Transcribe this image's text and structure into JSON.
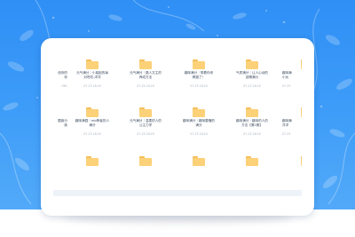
{
  "file_rows": [
    [
      {
        "name": "信你的\n你",
        "date": "ORL",
        "partial": "left"
      },
      {
        "name": "元气满分｜小姐姐的每\n对吃吃-洋洋",
        "date": "07-23 16:20"
      },
      {
        "name": "元气满分｜路人文主的\n养成方法",
        "date": "07-23 16:20"
      },
      {
        "name": "趣味满分｜带着你来\n教猫了！",
        "date": "07-23 16:20"
      },
      {
        "name": "气质满分｜让人心动的\n欲情满分",
        "date": "07-23 16:20"
      },
      {
        "name": "趣味满\n小伙",
        "date": "07-23",
        "partial": "right"
      }
    ],
    [
      {
        "name": "酸爽分\n妹",
        "date": "",
        "partial": "left"
      },
      {
        "name": "趣味满园｜mb等者的人\n满分",
        "date": "07-23 16:20"
      },
      {
        "name": "元气满分｜温柔的人的\n公主力学",
        "date": "07-23 16:20"
      },
      {
        "name": "趣味满分｜趣味要懂的\n满分",
        "date": "07-23 16:20"
      },
      {
        "name": "趣味满分｜趣味的人的\n方法【第2期】",
        "date": "07-23 16:20"
      },
      {
        "name": "趣味满\n洋洋",
        "date": "07-23",
        "partial": "right"
      }
    ],
    [
      {
        "name": "",
        "date": "",
        "partial": "left"
      },
      {
        "name": "",
        "date": ""
      },
      {
        "name": "",
        "date": ""
      },
      {
        "name": "",
        "date": ""
      },
      {
        "name": "",
        "date": ""
      },
      {
        "name": "",
        "date": "",
        "partial": "right"
      }
    ]
  ]
}
